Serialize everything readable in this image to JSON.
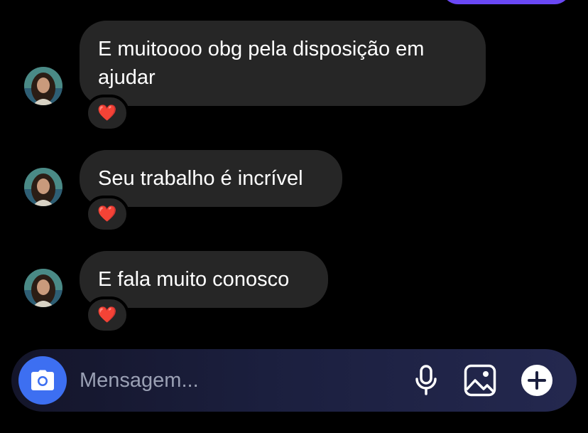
{
  "messages": [
    {
      "text": "E muitoooo obg pela disposição em ajudar",
      "reaction": "❤️"
    },
    {
      "text": "Seu trabalho é incrível",
      "reaction": "❤️"
    },
    {
      "text": "E fala muito conosco",
      "reaction": "❤️"
    }
  ],
  "composer": {
    "placeholder": "Mensagem...",
    "icons": [
      "camera-icon",
      "microphone-icon",
      "image-icon",
      "plus-icon"
    ]
  },
  "colors": {
    "bubble": "#262626",
    "sent_bubble": "#6a48f5",
    "camera_button": "#3d6ff1",
    "background": "#000000"
  }
}
